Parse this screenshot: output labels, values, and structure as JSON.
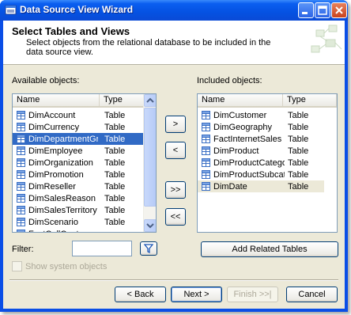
{
  "window": {
    "title": "Data Source View Wizard"
  },
  "header": {
    "title": "Select Tables and Views",
    "description": "Select objects from the relational database to be included in the data source view."
  },
  "available": {
    "label": "Available objects:",
    "columns": {
      "name": "Name",
      "type": "Type"
    },
    "rows": [
      {
        "name": "DimAccount",
        "type": "Table"
      },
      {
        "name": "DimCurrency",
        "type": "Table"
      },
      {
        "name": "DimDepartmentGr...",
        "type": "Table"
      },
      {
        "name": "DimEmployee",
        "type": "Table"
      },
      {
        "name": "DimOrganization",
        "type": "Table"
      },
      {
        "name": "DimPromotion",
        "type": "Table"
      },
      {
        "name": "DimReseller",
        "type": "Table"
      },
      {
        "name": "DimSalesReason",
        "type": "Table"
      },
      {
        "name": "DimSalesTerritory",
        "type": "Table"
      },
      {
        "name": "DimScenario",
        "type": "Table"
      },
      {
        "name": "FactCallCenter",
        "type": ""
      }
    ]
  },
  "included": {
    "label": "Included objects:",
    "columns": {
      "name": "Name",
      "type": "Type"
    },
    "rows": [
      {
        "name": "DimCustomer",
        "type": "Table"
      },
      {
        "name": "DimGeography",
        "type": "Table"
      },
      {
        "name": "FactInternetSales",
        "type": "Table"
      },
      {
        "name": "DimProduct",
        "type": "Table"
      },
      {
        "name": "DimProductCategory",
        "type": "Table"
      },
      {
        "name": "DimProductSubcat...",
        "type": "Table"
      },
      {
        "name": "DimDate",
        "type": "Table"
      }
    ]
  },
  "transfer": {
    "add": ">",
    "remove": "<",
    "add_all": ">>",
    "remove_all": "<<"
  },
  "filter": {
    "label": "Filter:",
    "value": ""
  },
  "show_system": {
    "label": "Show system objects",
    "checked": false
  },
  "add_related_label": "Add Related Tables",
  "nav": {
    "back": "< Back",
    "next": "Next >",
    "finish": "Finish >>|",
    "cancel": "Cancel"
  },
  "colors": {
    "selection": "#316ac5",
    "titlebar": "#0552e2",
    "face": "#ece9d8"
  }
}
